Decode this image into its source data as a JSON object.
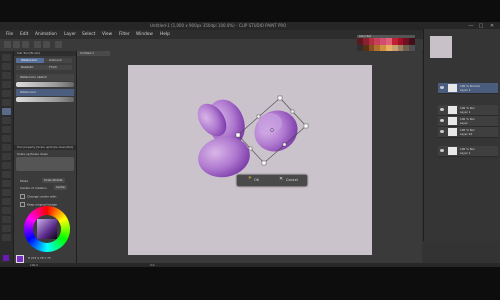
{
  "window": {
    "title": "Untitled-1 (1,000 x 900px 350dpi 100.0%) - CLIP STUDIO PAINT PRO",
    "controls": [
      "—",
      "□",
      "✕"
    ]
  },
  "menubar": {
    "items": [
      "File",
      "Edit",
      "Animation",
      "Layer",
      "Select",
      "View",
      "Filter",
      "Window",
      "Help"
    ]
  },
  "color_set": {
    "label": "Color Set",
    "swatches": [
      "#5a1a20",
      "#8a2030",
      "#b03040",
      "#c84058",
      "#d04e6e",
      "#e0607a",
      "#c02030",
      "#a01028",
      "#701020",
      "#401018",
      "#303030",
      "#5a3010",
      "#8a5020",
      "#b07030",
      "#d09040",
      "#e8b060",
      "#c8a070",
      "#a08060",
      "#706050",
      "#505050"
    ]
  },
  "tool_property": {
    "tabs": [
      "Sub Tool [Brush]"
    ],
    "subtools": [
      "Watercolor",
      "Airbrush",
      "Realistic",
      "Thick"
    ],
    "brushes": [
      "Watercolor sketch",
      "Watercolor"
    ],
    "panel_title": "Tool property [Scale up/Scale down/Rot]",
    "scale_label": "Scale up/Scale down",
    "mode_label": "Mode",
    "mode_value": "Scale /Rotate",
    "center_label": "Center of rotation",
    "center_value": "Center",
    "change_label": "Change center with",
    "keep_label": "Keep original image"
  },
  "color": {
    "main": "#7a30c8",
    "sub": "#6a1bb5",
    "values": "H 272  S 78  V 75"
  },
  "canvas": {
    "doc_tab": "Untitled-1",
    "bg": "#cbc3cb",
    "petal_light": "#c59ad9",
    "petal_dark": "#7a34b0"
  },
  "transform_confirm": {
    "ok_icon": "✳",
    "ok_label": "OK",
    "cancel_icon": "✕",
    "cancel_label": "Cancel"
  },
  "layers": {
    "rows": [
      {
        "line1": "100 % Normal",
        "line2": "Layer 2"
      },
      {
        "line1": "100 % Nor",
        "line2": "Layer 1"
      },
      {
        "line1": "100 % Nor",
        "line2": "Layer"
      },
      {
        "line1": "100 % Nor",
        "line2": "Layer 10"
      },
      {
        "line1": "100 % Nor",
        "line2": "Layer 1"
      }
    ]
  },
  "status": {
    "zoom": "100.0",
    "angle": "0.0"
  }
}
